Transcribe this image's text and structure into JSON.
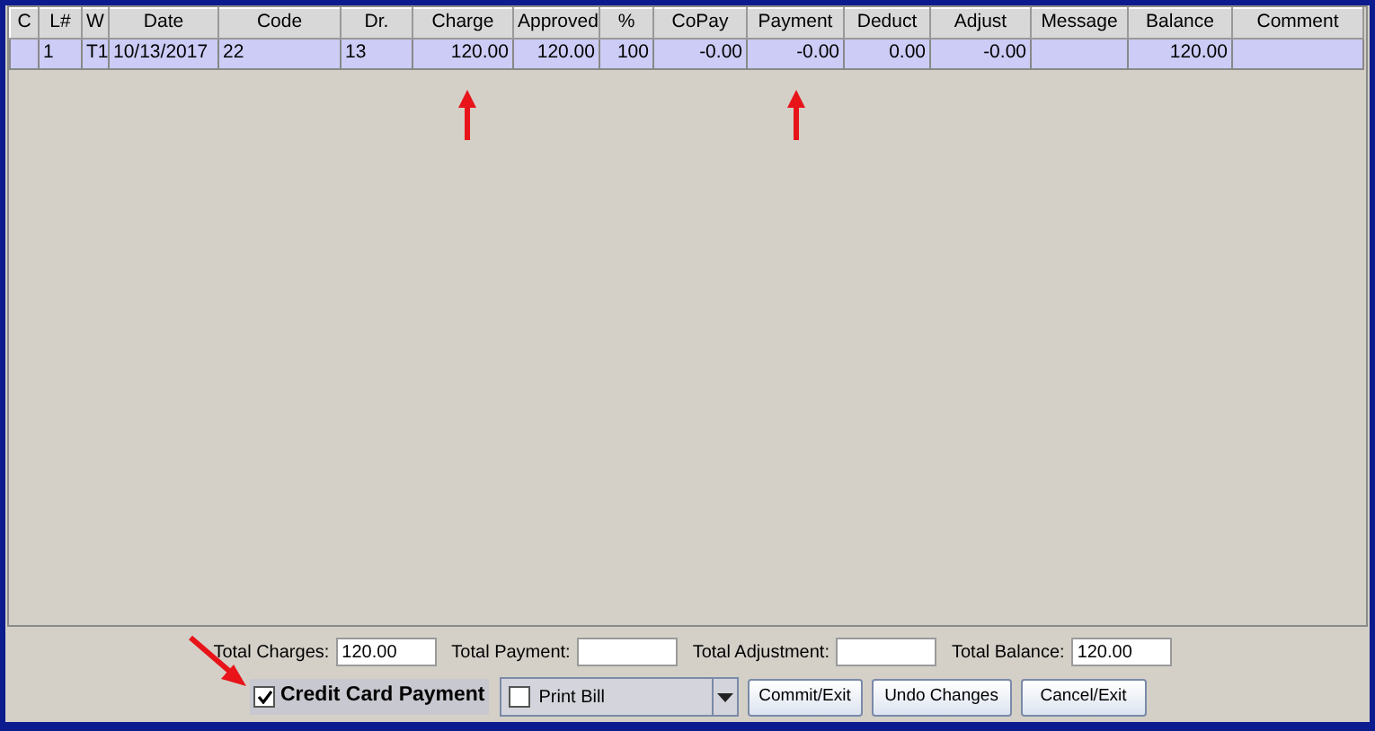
{
  "table": {
    "columns": [
      "C",
      "L#",
      "W",
      "Date",
      "Code",
      "Dr.",
      "Charge",
      "Approved",
      "%",
      "CoPay",
      "Payment",
      "Deduct",
      "Adjust",
      "Message",
      "Balance",
      "Comment"
    ],
    "rows": [
      {
        "selected": true,
        "cells": [
          "",
          "1",
          "T1",
          "10/13/2017",
          "22",
          "13",
          "120.00",
          "120.00",
          "100",
          "-0.00",
          "-0.00",
          "0.00",
          "-0.00",
          "",
          "120.00",
          ""
        ]
      }
    ]
  },
  "totals": [
    {
      "label": "Total Charges:",
      "value": "120.00"
    },
    {
      "label": "Total Payment:"
    },
    {
      "label": "Total Adjustment:"
    },
    {
      "label": "Total Balance:",
      "value": "120.00"
    }
  ],
  "credit_card_payment": {
    "label": "Credit Card Payment",
    "checked": true
  },
  "print_bill": {
    "label": "Print Bill",
    "checked": false
  },
  "buttons": [
    "Commit/Exit",
    "Undo Changes",
    "Cancel/Exit"
  ]
}
